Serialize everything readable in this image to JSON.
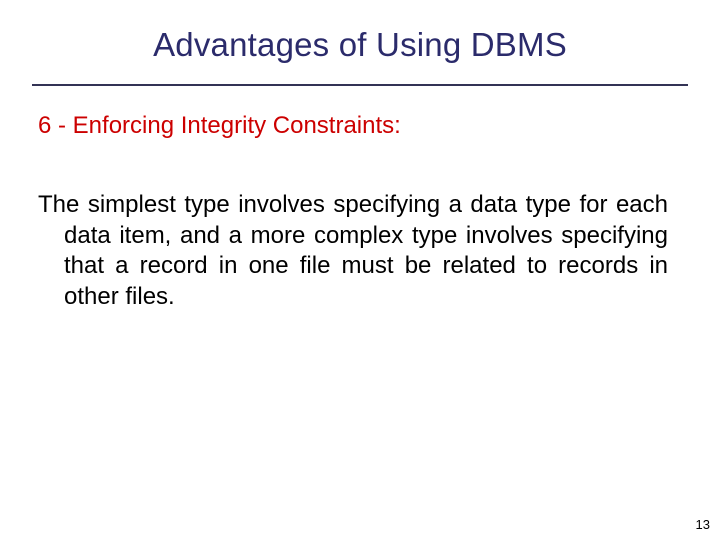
{
  "slide": {
    "title": "Advantages of Using DBMS",
    "subheading": "6 - Enforcing Integrity Constraints:",
    "body": "The simplest type involves specifying a data type for each data item, and a more complex type involves specifying that a record in one file must be related to records in other files.",
    "page_number": "13"
  }
}
